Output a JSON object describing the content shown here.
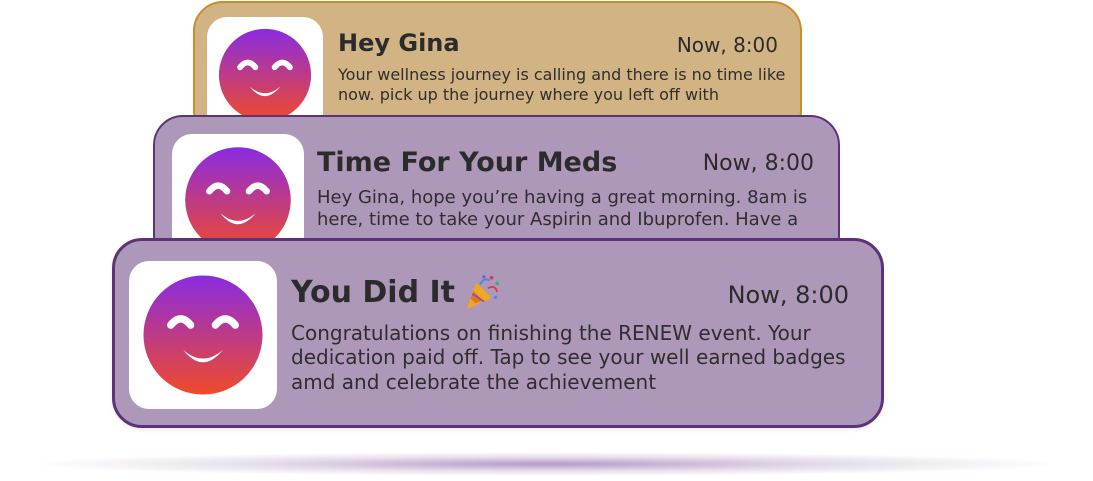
{
  "notifications": [
    {
      "title": "Hey Gina",
      "time": "Now, 8:00",
      "body": "Your wellness journey is calling and there is no time like now. pick up the journey where you left off with",
      "icon": "smiley-app-icon"
    },
    {
      "title": "Time For Your Meds",
      "time": "Now, 8:00",
      "body": "Hey Gina, hope you’re having a great morning. 8am is here, time to take your Aspirin and Ibuprofen. Have a",
      "icon": "smiley-app-icon"
    },
    {
      "title": "You Did It",
      "title_emoji": "party-popper-icon",
      "time": "Now, 8:00",
      "body": "Congratulations on finishing the RENEW event. Your dedication paid off. Tap to see your well earned badges amd and celebrate the achievement",
      "icon": "smiley-app-icon"
    }
  ],
  "colors": {
    "card1_bg": "#d2b384",
    "card1_border": "#c98d2c",
    "card_purple_bg": "#ae98ba",
    "card_purple_border": "#5e3278",
    "icon_gradient_top": "#8a2be2",
    "icon_gradient_bottom": "#f04a2a"
  }
}
